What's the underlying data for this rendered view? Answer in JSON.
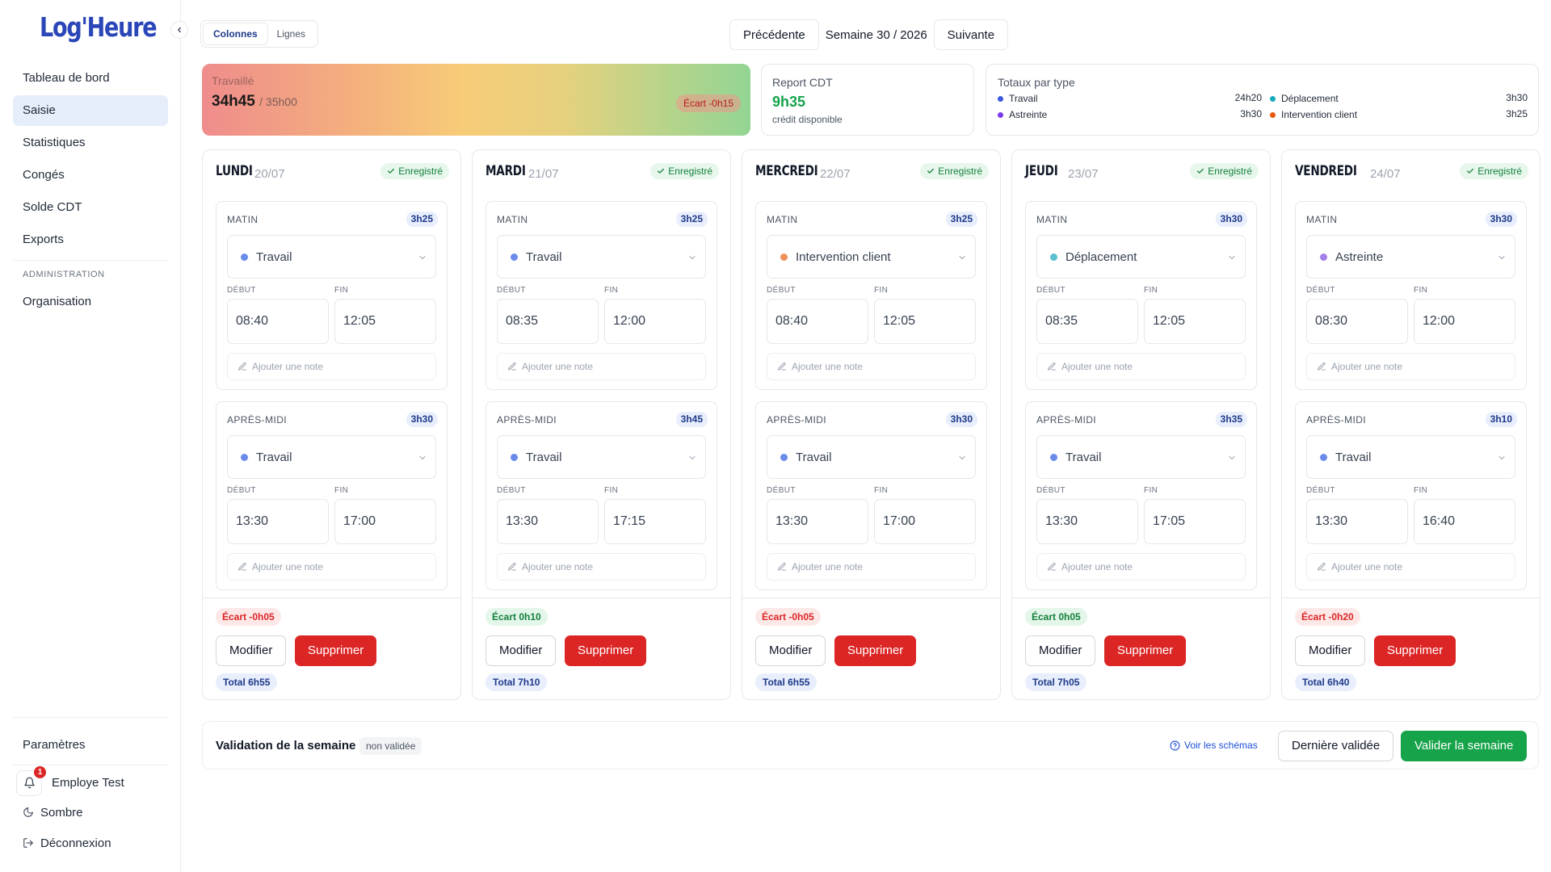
{
  "app": {
    "logo": "Log'Heure"
  },
  "sidebar": {
    "items": [
      {
        "label": "Tableau de bord"
      },
      {
        "label": "Saisie"
      },
      {
        "label": "Statistiques"
      },
      {
        "label": "Congés"
      },
      {
        "label": "Solde CDT"
      },
      {
        "label": "Exports"
      }
    ],
    "admin_section": "ADMINISTRATION",
    "admin_items": [
      {
        "label": "Organisation"
      }
    ],
    "settings": "Paramètres",
    "user_name": "Employe Test",
    "notif_count": "1",
    "theme_label": "Sombre",
    "logout_label": "Déconnexion"
  },
  "topbar": {
    "view_columns": "Colonnes",
    "view_rows": "Lignes",
    "prev": "Précédente",
    "week": "Semaine 30 / 2026",
    "next": "Suivante"
  },
  "summary": {
    "worked_label": "Travaillé",
    "worked_value": "34h45",
    "worked_target": "/ 35h00",
    "worked_ecart": "Écart -0h15",
    "cdt_label": "Report CDT",
    "cdt_value": "9h35",
    "cdt_sub": "crédit disponible",
    "totals_label": "Totaux par type",
    "totals": [
      {
        "label": "Travail",
        "value": "24h20",
        "color": "#3b5bdb"
      },
      {
        "label": "Déplacement",
        "value": "3h30",
        "color": "#15aabf"
      },
      {
        "label": "Astreinte",
        "value": "3h30",
        "color": "#7c3aed"
      },
      {
        "label": "Intervention client",
        "value": "3h25",
        "color": "#ea580c"
      }
    ]
  },
  "labels": {
    "saved": "Enregistré",
    "morning": "MATIN",
    "afternoon": "APRÈS-MIDI",
    "start": "DÉBUT",
    "end": "FIN",
    "note_placeholder": "Ajouter une note",
    "modify": "Modifier",
    "delete": "Supprimer"
  },
  "days": [
    {
      "name": "LUNDI",
      "date": "20/07",
      "morning": {
        "duration": "3h25",
        "type": "Travail",
        "type_color": "#6b8be8",
        "start": "08:40",
        "end": "12:05"
      },
      "afternoon": {
        "duration": "3h30",
        "type": "Travail",
        "type_color": "#6b8be8",
        "start": "13:30",
        "end": "17:00"
      },
      "ecart": "Écart -0h05",
      "ecart_kind": "neg",
      "total": "Total 6h55"
    },
    {
      "name": "MARDI",
      "date": "21/07",
      "morning": {
        "duration": "3h25",
        "type": "Travail",
        "type_color": "#6b8be8",
        "start": "08:35",
        "end": "12:00"
      },
      "afternoon": {
        "duration": "3h45",
        "type": "Travail",
        "type_color": "#6b8be8",
        "start": "13:30",
        "end": "17:15"
      },
      "ecart": "Écart 0h10",
      "ecart_kind": "pos",
      "total": "Total 7h10"
    },
    {
      "name": "MERCREDI",
      "date": "22/07",
      "morning": {
        "duration": "3h25",
        "type": "Intervention client",
        "type_color": "#f0915a",
        "start": "08:40",
        "end": "12:05"
      },
      "afternoon": {
        "duration": "3h30",
        "type": "Travail",
        "type_color": "#6b8be8",
        "start": "13:30",
        "end": "17:00"
      },
      "ecart": "Écart -0h05",
      "ecart_kind": "neg",
      "total": "Total 6h55"
    },
    {
      "name": "JEUDI",
      "date": "23/07",
      "morning": {
        "duration": "3h30",
        "type": "Déplacement",
        "type_color": "#5bbfd0",
        "start": "08:35",
        "end": "12:05"
      },
      "afternoon": {
        "duration": "3h35",
        "type": "Travail",
        "type_color": "#6b8be8",
        "start": "13:30",
        "end": "17:05"
      },
      "ecart": "Écart 0h05",
      "ecart_kind": "pos",
      "total": "Total 7h05"
    },
    {
      "name": "VENDREDI",
      "date": "24/07",
      "morning": {
        "duration": "3h30",
        "type": "Astreinte",
        "type_color": "#a37fe8",
        "start": "08:30",
        "end": "12:00"
      },
      "afternoon": {
        "duration": "3h10",
        "type": "Travail",
        "type_color": "#6b8be8",
        "start": "13:30",
        "end": "16:40"
      },
      "ecart": "Écart -0h20",
      "ecart_kind": "neg",
      "total": "Total 6h40"
    }
  ],
  "validation": {
    "title": "Validation de la semaine",
    "status": "non validée",
    "schemas_link": "Voir les schémas",
    "last_validated": "Dernière validée",
    "validate": "Valider la semaine"
  }
}
